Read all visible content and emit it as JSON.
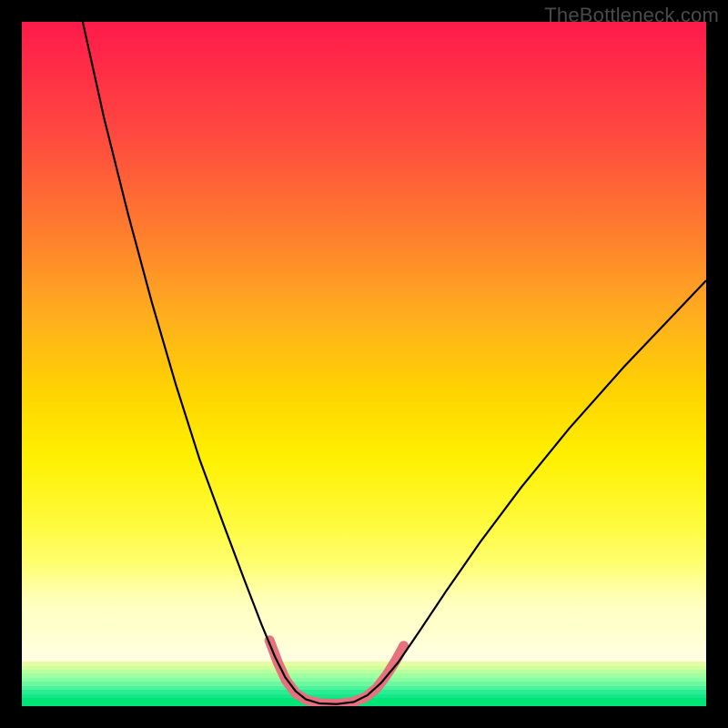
{
  "watermark": "TheBottleneck.com",
  "chart_data": {
    "type": "line",
    "title": "",
    "xlabel": "",
    "ylabel": "",
    "xlim": [
      0,
      100
    ],
    "ylim": [
      0,
      100
    ],
    "grid": false,
    "legend": false,
    "gradient_stops": [
      {
        "pos": 0,
        "color": "#ff1a4b"
      },
      {
        "pos": 18,
        "color": "#ff4a3f"
      },
      {
        "pos": 46,
        "color": "#ffae1e"
      },
      {
        "pos": 68,
        "color": "#fff000"
      },
      {
        "pos": 92,
        "color": "#ffffc4"
      },
      {
        "pos": 100,
        "color": "#ffffe8"
      }
    ],
    "bottom_stripes": [
      "#e4ffa0",
      "#d0ff9e",
      "#b8ff9e",
      "#a0ffa0",
      "#86ffa2",
      "#6cf7a0",
      "#4ef29c",
      "#2aec92",
      "#16e88a",
      "#00e37e",
      "#00e676"
    ],
    "series": [
      {
        "name": "bottleneck-curve",
        "stroke": "#000000",
        "stroke_width": 2.2,
        "points": [
          {
            "x": 8.9,
            "y": 100.0
          },
          {
            "x": 12.0,
            "y": 86.0
          },
          {
            "x": 15.5,
            "y": 72.0
          },
          {
            "x": 19.0,
            "y": 59.0
          },
          {
            "x": 22.5,
            "y": 47.0
          },
          {
            "x": 26.0,
            "y": 36.0
          },
          {
            "x": 29.5,
            "y": 26.5
          },
          {
            "x": 32.5,
            "y": 18.5
          },
          {
            "x": 35.0,
            "y": 12.0
          },
          {
            "x": 37.0,
            "y": 7.2
          },
          {
            "x": 38.5,
            "y": 4.2
          },
          {
            "x": 40.0,
            "y": 2.2
          },
          {
            "x": 41.5,
            "y": 1.0
          },
          {
            "x": 43.5,
            "y": 0.4
          },
          {
            "x": 46.0,
            "y": 0.3
          },
          {
            "x": 48.5,
            "y": 0.6
          },
          {
            "x": 50.5,
            "y": 1.6
          },
          {
            "x": 52.5,
            "y": 3.4
          },
          {
            "x": 55.0,
            "y": 6.4
          },
          {
            "x": 58.0,
            "y": 10.8
          },
          {
            "x": 62.0,
            "y": 16.8
          },
          {
            "x": 67.0,
            "y": 24.0
          },
          {
            "x": 73.0,
            "y": 32.0
          },
          {
            "x": 80.0,
            "y": 40.6
          },
          {
            "x": 88.0,
            "y": 49.6
          },
          {
            "x": 96.0,
            "y": 58.0
          },
          {
            "x": 100.0,
            "y": 62.2
          }
        ]
      },
      {
        "name": "highlight-band",
        "stroke": "#e8717e",
        "stroke_width": 11,
        "linecap": "round",
        "points": [
          {
            "x": 36.2,
            "y": 9.6
          },
          {
            "x": 37.4,
            "y": 6.4
          },
          {
            "x": 38.6,
            "y": 3.8
          },
          {
            "x": 40.0,
            "y": 1.9
          },
          {
            "x": 41.6,
            "y": 0.9
          },
          {
            "x": 43.6,
            "y": 0.4
          },
          {
            "x": 46.0,
            "y": 0.3
          },
          {
            "x": 48.4,
            "y": 0.6
          },
          {
            "x": 50.2,
            "y": 1.3
          },
          {
            "x": 51.8,
            "y": 2.6
          },
          {
            "x": 53.2,
            "y": 4.4
          },
          {
            "x": 54.6,
            "y": 6.6
          },
          {
            "x": 55.8,
            "y": 8.8
          }
        ]
      }
    ]
  }
}
